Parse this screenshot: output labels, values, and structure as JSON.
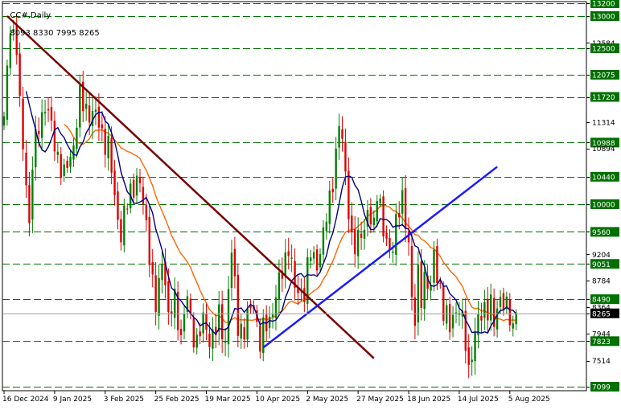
{
  "header": {
    "symbol": "CC#,Daily",
    "ohlc": "8093 8330 7995 8265"
  },
  "colors": {
    "background": "#ffffff",
    "bull": "#008000",
    "bear": "#e00000",
    "level_line": "#007000",
    "ma_fast": "#000080",
    "ma_slow": "#ff6600",
    "down_trend": "#7a0000",
    "up_trend": "#1a1aff",
    "price_tag": "#000000"
  },
  "chart_data": {
    "type": "candlestick",
    "title": "CC#,Daily",
    "last_price": 8265,
    "y_range": [
      7000,
      13250
    ],
    "grid": false,
    "horizontal_levels": [
      13200,
      13000,
      12500,
      12075,
      11720,
      10988,
      10440,
      10000,
      9560,
      9051,
      8490,
      7823,
      7099
    ],
    "highlighted_levels": [
      13200,
      13000,
      12500,
      12075,
      11720,
      10988,
      10440,
      10000,
      9560,
      9051,
      8490,
      7823,
      7099
    ],
    "y_tick_labels": [
      "13200",
      "13000",
      "12584",
      "12500",
      "12075",
      "11720",
      "11314",
      "10988",
      "10894",
      "10440",
      "10000",
      "9560",
      "9204",
      "9051",
      "8784",
      "8490",
      "8364",
      "8265",
      "7944",
      "7823",
      "7514",
      "7099"
    ],
    "x_tick_labels": [
      "16 Dec 2024",
      "9 Jan 2025",
      "3 Feb 2025",
      "25 Feb 2025",
      "19 Mar 2025",
      "10 Apr 2025",
      "2 May 2025",
      "27 May 2025",
      "18 Jun 2025",
      "14 Jul 2025",
      "5 Aug 2025"
    ],
    "x_ticks": [
      {
        "label": "16 Dec 2024",
        "bar": 0
      },
      {
        "label": "9 Jan 2025",
        "bar": 16
      },
      {
        "label": "3 Feb 2025",
        "bar": 32
      },
      {
        "label": "25 Feb 2025",
        "bar": 48
      },
      {
        "label": "19 Mar 2025",
        "bar": 64
      },
      {
        "label": "10 Apr 2025",
        "bar": 80
      },
      {
        "label": "2 May 2025",
        "bar": 96
      },
      {
        "label": "27 May 2025",
        "bar": 112
      },
      {
        "label": "18 Jun 2025",
        "bar": 128
      },
      {
        "label": "14 Jul 2025",
        "bar": 144
      },
      {
        "label": "5 Aug 2025",
        "bar": 160
      }
    ],
    "bars_total": 173,
    "price_path": [
      [
        0,
        11300
      ],
      [
        2,
        12950
      ],
      [
        4,
        12500
      ],
      [
        5,
        11500
      ],
      [
        7,
        10400
      ],
      [
        8,
        9700
      ],
      [
        9,
        10600
      ],
      [
        11,
        11300
      ],
      [
        13,
        11600
      ],
      [
        16,
        11000
      ],
      [
        19,
        10400
      ],
      [
        22,
        11000
      ],
      [
        24,
        11650
      ],
      [
        27,
        11500
      ],
      [
        30,
        11300
      ],
      [
        33,
        10900
      ],
      [
        35,
        10100
      ],
      [
        37,
        9550
      ],
      [
        40,
        10200
      ],
      [
        42,
        10450
      ],
      [
        44,
        10000
      ],
      [
        46,
        9300
      ],
      [
        47,
        8750
      ],
      [
        48,
        8300
      ],
      [
        50,
        9100
      ],
      [
        51,
        8900
      ],
      [
        52,
        8150
      ],
      [
        54,
        8450
      ],
      [
        56,
        7950
      ],
      [
        58,
        8500
      ],
      [
        59,
        8100
      ],
      [
        61,
        7850
      ],
      [
        63,
        8100
      ],
      [
        65,
        7900
      ],
      [
        67,
        8000
      ],
      [
        68,
        8150
      ],
      [
        70,
        7850
      ],
      [
        71,
        8700
      ],
      [
        72,
        9200
      ],
      [
        74,
        8100
      ],
      [
        76,
        8000
      ],
      [
        79,
        8450
      ],
      [
        81,
        7800
      ],
      [
        84,
        8200
      ],
      [
        87,
        8700
      ],
      [
        90,
        9400
      ],
      [
        92,
        8600
      ],
      [
        95,
        8650
      ],
      [
        97,
        9200
      ],
      [
        99,
        9100
      ],
      [
        101,
        9450
      ],
      [
        103,
        10100
      ],
      [
        105,
        10800
      ],
      [
        106,
        11200
      ],
      [
        107,
        11000
      ],
      [
        108,
        10500
      ],
      [
        109,
        10000
      ],
      [
        110,
        9400
      ],
      [
        111,
        9250
      ],
      [
        113,
        9600
      ],
      [
        115,
        9800
      ],
      [
        117,
        9600
      ],
      [
        118,
        10300
      ],
      [
        119,
        10050
      ],
      [
        120,
        9500
      ],
      [
        122,
        9200
      ],
      [
        124,
        9750
      ],
      [
        126,
        10000
      ],
      [
        127,
        9700
      ],
      [
        128,
        9500
      ],
      [
        129,
        8500
      ],
      [
        130,
        8100
      ],
      [
        131,
        8800
      ],
      [
        132,
        8550
      ],
      [
        133,
        8900
      ],
      [
        135,
        8600
      ],
      [
        136,
        9150
      ],
      [
        138,
        8700
      ],
      [
        139,
        8300
      ],
      [
        141,
        8000
      ],
      [
        142,
        8300
      ],
      [
        144,
        8350
      ],
      [
        145,
        8050
      ],
      [
        146,
        7800
      ],
      [
        147,
        7400
      ],
      [
        148,
        7700
      ],
      [
        150,
        8100
      ],
      [
        152,
        8400
      ],
      [
        154,
        8350
      ],
      [
        155,
        8050
      ],
      [
        157,
        8600
      ],
      [
        159,
        8300
      ],
      [
        161,
        8000
      ],
      [
        162,
        8330
      ]
    ],
    "trend_lines": [
      {
        "name": "Descending trendline",
        "from": [
          1,
          13000
        ],
        "to": [
          117,
          7550
        ]
      },
      {
        "name": "Ascending trendline",
        "from": [
          82,
          7720
        ],
        "to": [
          156,
          10600
        ]
      }
    ]
  }
}
